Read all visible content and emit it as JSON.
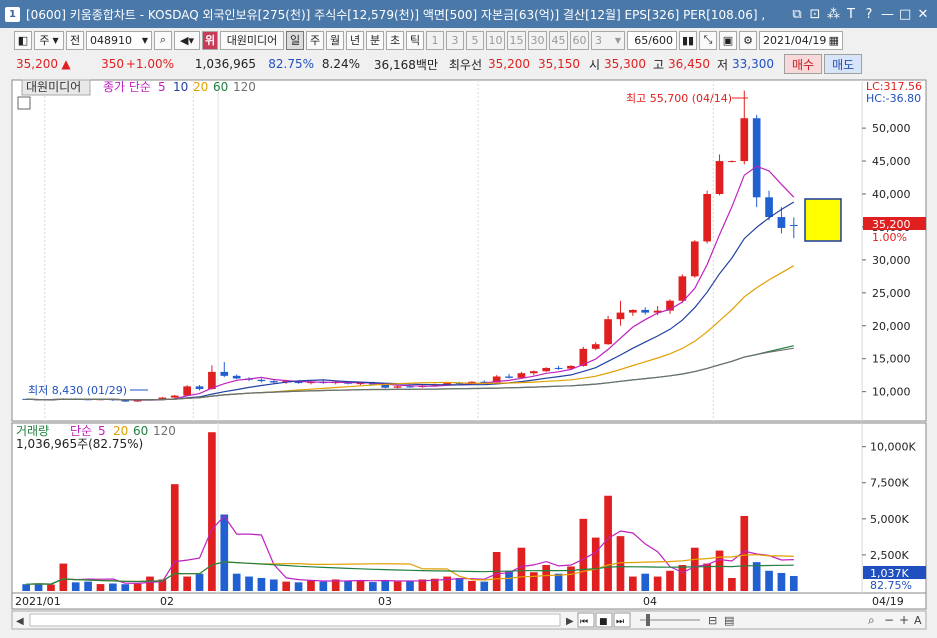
{
  "title": "[0600] 키움종합차트 - KOSDAQ 외국인보유[275(천)] 주식수[12,579(천)] 액면[500] 자본금[63(억)] 결산[12월] EPS[326] PER[108.06] ,",
  "title_badge": "1",
  "window_buttons": [
    "⧉",
    "⊡",
    "⁂",
    "T",
    "?",
    "—",
    "□",
    "✕"
  ],
  "toolbar": {
    "market": "주",
    "market2": "전",
    "code": "048910",
    "name_badge": "위",
    "name": "대원미디어",
    "periods": [
      "일",
      "주",
      "월",
      "년",
      "분",
      "초",
      "틱"
    ],
    "intervals": [
      "1",
      "3",
      "5",
      "10",
      "15",
      "30",
      "45",
      "60"
    ],
    "count_value": "3",
    "range": "65/600",
    "date": "2021/04/19"
  },
  "quote": {
    "price": "35,200",
    "arrow": "▲",
    "change": "350",
    "pct": "+1.00%",
    "volume": "1,036,965",
    "vol_pct": "82.75%",
    "turnover_pct": "8.24%",
    "amount": "36,168백만",
    "best_label": "최우선",
    "ask": "35,200",
    "bid": "35,150",
    "open_label": "시",
    "open": "35,300",
    "high_label": "고",
    "high": "36,450",
    "low_label": "저",
    "low": "33,300",
    "buy": "매수",
    "sell": "매도"
  },
  "price_pane": {
    "name_tag": "대원미디어",
    "ma_label": "종가 단순",
    "ma_periods": [
      "5",
      "10",
      "20",
      "60",
      "120"
    ],
    "lc": "LC:317.56",
    "hc": "HC:-36.80",
    "price_tag": "35,200",
    "pct_tag": "1.00%",
    "high_note": "최고 55,700 (04/14)",
    "low_note": "최저 8,430 (01/29)",
    "y_ticks": [
      "50,000",
      "45,000",
      "40,000",
      "35,000",
      "30,000",
      "25,000",
      "20,000",
      "15,000",
      "10,000"
    ]
  },
  "volume_pane": {
    "label": "거래량",
    "ma_label": "단순",
    "ma_periods": [
      "5",
      "20",
      "60",
      "120"
    ],
    "vol_text": "1,036,965주(82.75%)",
    "y_ticks": [
      "10,000K",
      "7,500K",
      "5,000K",
      "2,500K"
    ],
    "vol_tag": "1,037K",
    "vol_pct_tag": "82.75%"
  },
  "x_axis": {
    "labels": [
      "2021/01",
      "02",
      "03",
      "04"
    ],
    "last": "04/19"
  },
  "colors": {
    "up": "#e02020",
    "down": "#2060d0",
    "ma5": "#c020c0",
    "ma10": "#2040a0",
    "ma20": "#e0a000",
    "ma60": "#208040",
    "ma120": "#707070",
    "accent": "#ffff00"
  },
  "chart_data": {
    "type": "candlestick",
    "x_labels": [
      "2021/01",
      "02",
      "03",
      "04"
    ],
    "y_range": [
      6000,
      57000
    ],
    "volume_range": [
      0,
      11500000
    ],
    "price_high": 55700,
    "price_low": 8430,
    "last": 35200,
    "candles": [
      [
        8900,
        8950,
        8800,
        8850,
        470000
      ],
      [
        8850,
        8900,
        8700,
        8750,
        520000
      ],
      [
        8750,
        8850,
        8700,
        8800,
        450000
      ],
      [
        8800,
        9000,
        8750,
        8950,
        1900000
      ],
      [
        8950,
        9000,
        8800,
        8850,
        600000
      ],
      [
        8850,
        8900,
        8700,
        8800,
        650000
      ],
      [
        8800,
        8900,
        8700,
        8850,
        480000
      ],
      [
        8850,
        8950,
        8600,
        8700,
        520000
      ],
      [
        8700,
        8750,
        8430,
        8500,
        470000
      ],
      [
        8500,
        8800,
        8450,
        8700,
        500000
      ],
      [
        8700,
        8900,
        8650,
        8850,
        1000000
      ],
      [
        8850,
        9200,
        8800,
        9100,
        800000
      ],
      [
        9100,
        9500,
        9000,
        9400,
        7400000
      ],
      [
        9400,
        11000,
        9300,
        10800,
        1000000
      ],
      [
        10800,
        11000,
        10200,
        10400,
        1200000
      ],
      [
        10400,
        14000,
        10300,
        13000,
        11000000
      ],
      [
        13000,
        14500,
        12200,
        12400,
        5300000
      ],
      [
        12400,
        12600,
        11900,
        12000,
        1200000
      ],
      [
        12000,
        12200,
        11600,
        11800,
        1000000
      ],
      [
        11800,
        12000,
        11400,
        11600,
        900000
      ],
      [
        11600,
        11900,
        11200,
        11400,
        800000
      ],
      [
        11400,
        11800,
        11200,
        11600,
        650000
      ],
      [
        11600,
        11700,
        11200,
        11300,
        600000
      ],
      [
        11300,
        11600,
        11100,
        11500,
        750000
      ],
      [
        11500,
        11700,
        11200,
        11300,
        650000
      ],
      [
        11300,
        11600,
        11100,
        11500,
        800000
      ],
      [
        11500,
        11600,
        11100,
        11200,
        700000
      ],
      [
        11200,
        11400,
        11000,
        11300,
        750000
      ],
      [
        11300,
        11500,
        11000,
        11100,
        620000
      ],
      [
        11100,
        11200,
        10500,
        10600,
        750000
      ],
      [
        10600,
        10900,
        10500,
        10800,
        650000
      ],
      [
        10800,
        11000,
        10600,
        10700,
        700000
      ],
      [
        10700,
        11000,
        10600,
        10900,
        800000
      ],
      [
        10900,
        11200,
        10800,
        11100,
        850000
      ],
      [
        11100,
        11400,
        11000,
        11300,
        1000000
      ],
      [
        11300,
        11500,
        11100,
        11200,
        900000
      ],
      [
        11200,
        11600,
        11100,
        11500,
        700000
      ],
      [
        11500,
        11700,
        11300,
        11400,
        650000
      ],
      [
        11400,
        12500,
        11400,
        12300,
        2700000
      ],
      [
        12300,
        12700,
        12000,
        12100,
        1400000
      ],
      [
        12100,
        13000,
        12000,
        12800,
        3000000
      ],
      [
        12800,
        13200,
        12500,
        13100,
        1300000
      ],
      [
        13100,
        13700,
        13000,
        13600,
        1800000
      ],
      [
        13600,
        13900,
        13300,
        13500,
        1200000
      ],
      [
        13500,
        14000,
        13400,
        13900,
        1700000
      ],
      [
        13900,
        16800,
        13800,
        16500,
        5000000
      ],
      [
        16500,
        17500,
        16300,
        17200,
        3700000
      ],
      [
        17200,
        21500,
        17100,
        21000,
        6600000
      ],
      [
        21000,
        23800,
        20000,
        22000,
        3800000
      ],
      [
        22000,
        22500,
        21500,
        22400,
        1000000
      ],
      [
        22400,
        22800,
        21700,
        22000,
        1200000
      ],
      [
        22000,
        23000,
        21600,
        22300,
        1000000
      ],
      [
        22300,
        24000,
        21800,
        23800,
        1400000
      ],
      [
        23800,
        27800,
        23500,
        27500,
        1800000
      ],
      [
        27500,
        33000,
        27300,
        32800,
        3000000
      ],
      [
        32800,
        40500,
        32500,
        40000,
        1900000
      ],
      [
        40000,
        46000,
        39800,
        45000,
        2800000
      ],
      [
        45000,
        45100,
        44800,
        45000,
        900000
      ],
      [
        45000,
        55700,
        44500,
        51500,
        5200000
      ],
      [
        51500,
        52000,
        38000,
        39500,
        2000000
      ],
      [
        39500,
        40500,
        36000,
        36500,
        1400000
      ],
      [
        36500,
        38000,
        34000,
        34850,
        1250000
      ],
      [
        35300,
        36450,
        33300,
        35200,
        1036965
      ]
    ]
  }
}
